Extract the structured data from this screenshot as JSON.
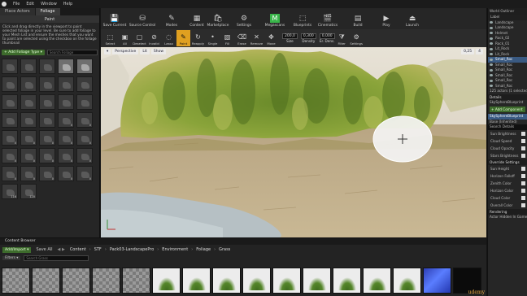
{
  "menu": [
    "File",
    "Edit",
    "Window",
    "Help"
  ],
  "left_panel": {
    "tabs": [
      "Place Actors",
      "Foliage"
    ],
    "mode": "Paint",
    "hint": "Click and drag directly in the viewport to paint selected foliage in your level. Be sure to add foliage to your Mesh List and ensure the meshes that you want to paint are selected using the checkbox on the foliage thumbnail",
    "add_button": "+ Add Foliage Type ▾",
    "search_placeholder": "Search Foliage",
    "tile_counts": [
      "",
      "",
      "",
      "",
      "",
      "",
      "",
      "",
      "",
      "",
      "",
      "",
      "",
      "",
      "",
      "",
      "",
      "",
      "0",
      "0",
      "0",
      "0",
      "0",
      "0",
      "0",
      "0",
      "0",
      "0",
      "0",
      "0",
      "0",
      "0",
      "0",
      "0",
      "0",
      "116",
      "120"
    ]
  },
  "toolbar": {
    "items": [
      {
        "label": "Save Current",
        "icon": "save-icon"
      },
      {
        "label": "Source Control",
        "icon": "source-control-icon"
      },
      {
        "label": "Modes",
        "icon": "modes-icon"
      },
      {
        "label": "Content",
        "icon": "content-icon"
      },
      {
        "label": "Marketplace",
        "icon": "marketplace-icon"
      },
      {
        "label": "Settings",
        "icon": "settings-icon"
      },
      {
        "label": "Megascans",
        "icon": "megascans-icon"
      },
      {
        "label": "Blueprints",
        "icon": "blueprints-icon"
      },
      {
        "label": "Cinematics",
        "icon": "cinematics-icon"
      },
      {
        "label": "Build",
        "icon": "build-icon"
      },
      {
        "label": "Play",
        "icon": "play-icon"
      },
      {
        "label": "Launch",
        "icon": "launch-icon"
      }
    ]
  },
  "modebar": {
    "items": [
      "Select",
      "All",
      "Deselect",
      "Invalid",
      "Lasso",
      "Paint",
      "Reapply",
      "Single",
      "Fill",
      "Erase",
      "Remove",
      "Move",
      "Filter",
      "Settings"
    ],
    "active": "Paint",
    "size_label": "Size",
    "size": "200,0",
    "density_label": "Density",
    "density": "0,300",
    "erase_label": "Er. Dens.",
    "erase": "0,000"
  },
  "viewport": {
    "menu_icon": "▾",
    "perspective": "Perspective",
    "lit": "Lit",
    "show": "Show",
    "snap_value": "0,25",
    "cam_speed": "4"
  },
  "outliner": {
    "title": "World Outliner",
    "column": "Label",
    "rows": [
      "Landscape",
      "Landscape",
      "Helmet",
      "Rock_02",
      "Rock_01",
      "Lit_Rock",
      "Lit_Rock",
      "Small_Roc",
      "Small_Roc",
      "Small_Roc",
      "Small_Roc",
      "Small_Roc",
      "Small_Roc"
    ],
    "selected_index": 7,
    "count": "125 actors (1 selected)"
  },
  "details": {
    "title": "Details",
    "actor": "SkySphereBlueprint",
    "add_component": "+ Add Component",
    "component": "SkySphereBlueprint",
    "base": "Base (Inherited)",
    "search": "Search Details",
    "props": [
      "Sun Brightness",
      "Cloud Speed",
      "Cloud Opacity",
      "Stars Brightness"
    ],
    "override_title": "Override Settings",
    "override_props": [
      "Sun Height",
      "Horizon Falloff",
      "Zenith Color",
      "Horizon Color",
      "Cloud Color",
      "Overall Color"
    ],
    "rendering": "Rendering",
    "actor_hidden": "Actor Hidden In Game"
  },
  "content_browser": {
    "tab": "Content Browser",
    "add_import": "Add/Import ▾",
    "save_all": "Save All",
    "path": [
      "Content",
      "STF",
      "Pack03-LandscapePro",
      "Environment",
      "Foliage",
      "Grass"
    ],
    "filters": "Filters ▾",
    "search_placeholder": "Search Grass",
    "thumbnails": [
      "checker",
      "checker",
      "checker",
      "checker",
      "checker",
      "grass",
      "grass",
      "grass",
      "grass",
      "grass",
      "grass",
      "grass",
      "grass",
      "grass",
      "blue",
      "dark"
    ]
  },
  "watermark": "udemy"
}
